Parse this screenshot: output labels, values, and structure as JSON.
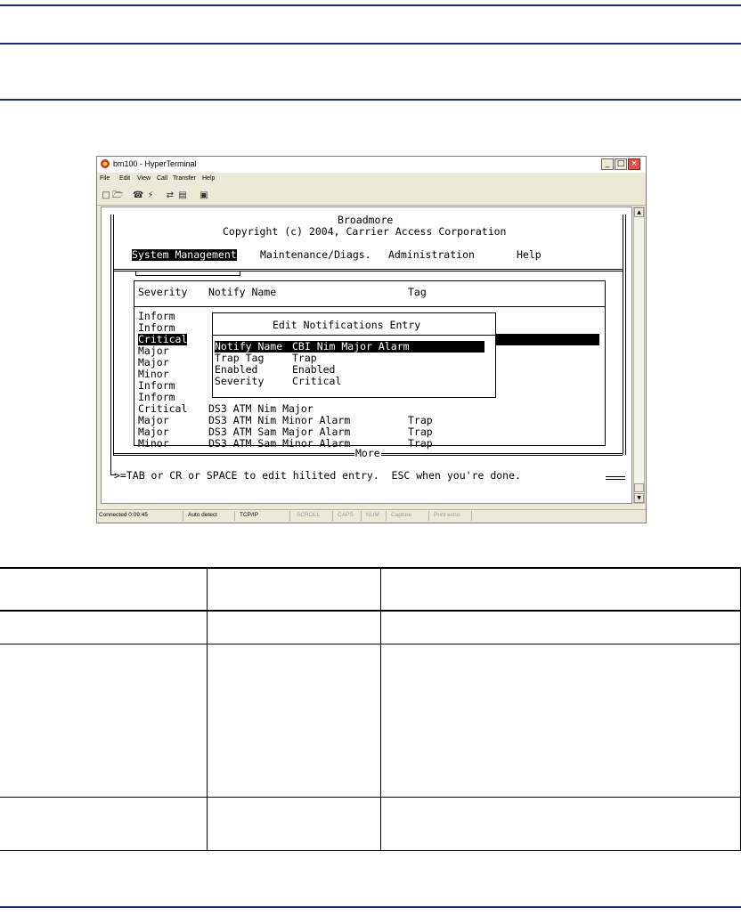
{
  "window": {
    "title": "bm100 - HyperTerminal",
    "menu": [
      "File",
      "Edit",
      "View",
      "Call",
      "Transfer",
      "Help"
    ],
    "controls": [
      "_",
      "□",
      "×"
    ]
  },
  "terminal": {
    "header_title": "Broadmore",
    "header_copyright": "Copyright (c) 2004, Carrier Access Corporation",
    "menu": [
      "System Management",
      "Maintenance/Diags.",
      "Administration",
      "Help"
    ],
    "columns": [
      "Severity",
      "Notify Name",
      "Tag"
    ],
    "rows": [
      {
        "severity": "Inform",
        "name": "",
        "tag": ""
      },
      {
        "severity": "Inform",
        "name": "",
        "tag": ""
      },
      {
        "severity": "Critical",
        "name": "",
        "tag": ""
      },
      {
        "severity": "Major",
        "name": "",
        "tag": ""
      },
      {
        "severity": "Major",
        "name": "",
        "tag": ""
      },
      {
        "severity": "Minor",
        "name": "",
        "tag": ""
      },
      {
        "severity": "Inform",
        "name": "",
        "tag": ""
      },
      {
        "severity": "Inform",
        "name": "",
        "tag": ""
      },
      {
        "severity": "Critical",
        "name": "DS3 ATM Nim Major",
        "tag": ""
      },
      {
        "severity": "Major",
        "name": "DS3 ATM Nim Minor Alarm",
        "tag": "Trap"
      },
      {
        "severity": "Major",
        "name": "DS3 ATM Sam Major Alarm",
        "tag": "Trap"
      },
      {
        "severity": "Minor",
        "name": "DS3 ATM Sam Minor Alarm",
        "tag": "Trap"
      }
    ],
    "more": "More",
    "dialog": {
      "title": "Edit Notifications Entry",
      "fields": [
        {
          "label": "Notify Name",
          "value": "CBI Nim Major Alarm"
        },
        {
          "label": "Trap Tag",
          "value": "Trap"
        },
        {
          "label": "Enabled",
          "value": "Enabled"
        },
        {
          "label": "Severity",
          "value": "Critical"
        }
      ]
    },
    "prompt": ">=TAB or CR or SPACE to edit hilited entry.  ESC when you're done."
  },
  "statusbar": {
    "connected": "Connected 0:09:45",
    "detect": "Auto detect",
    "protocol": "TCP/IP",
    "scroll": "SCROLL",
    "caps": "CAPS",
    "num": "NUM",
    "capture": "Capture",
    "print_echo": "Print echo"
  }
}
